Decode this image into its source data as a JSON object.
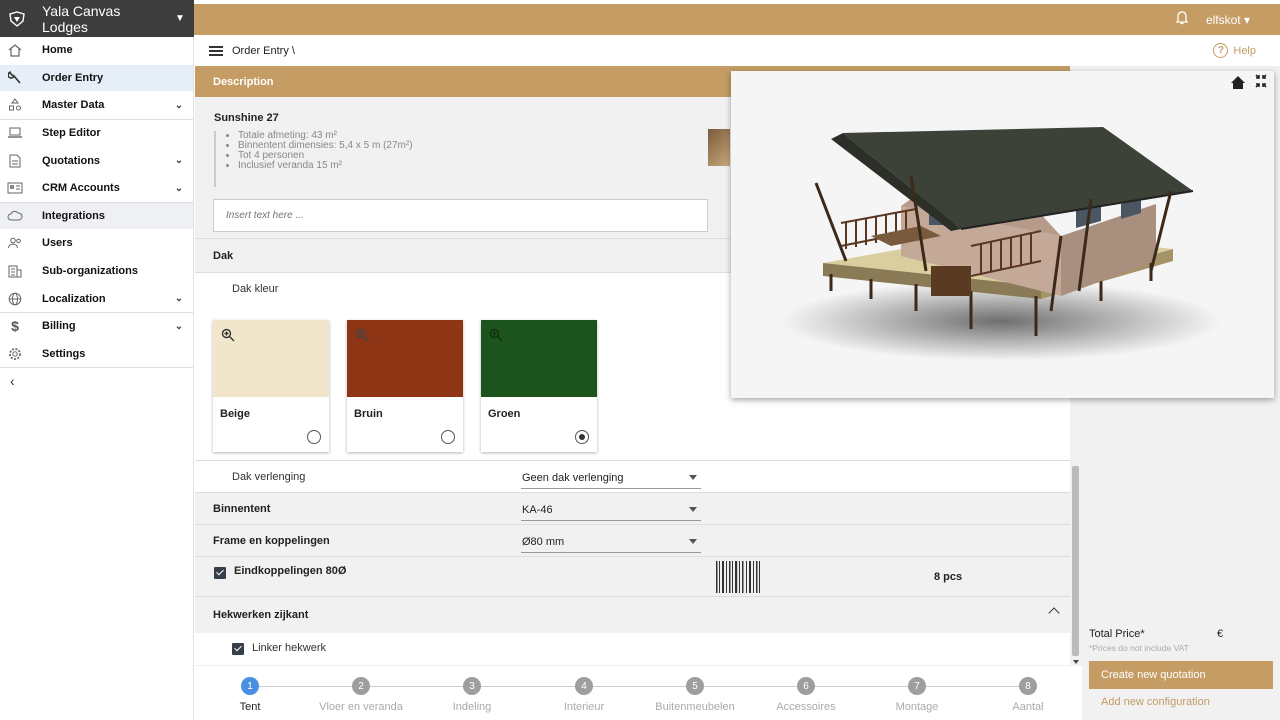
{
  "brand": {
    "name": "Yala Canvas Lodges"
  },
  "topbar": {
    "user": "elfskot"
  },
  "sidebar": {
    "items": [
      {
        "label": "Home",
        "icon": "home-icon"
      },
      {
        "label": "Order Entry",
        "icon": "wrench-icon"
      },
      {
        "label": "Master Data",
        "icon": "shapes-icon"
      },
      {
        "label": "Step Editor",
        "icon": "laptop-icon"
      },
      {
        "label": "Quotations",
        "icon": "document-icon"
      },
      {
        "label": "CRM Accounts",
        "icon": "id-card-icon"
      },
      {
        "label": "Integrations",
        "icon": "cloud-icon"
      },
      {
        "label": "Users",
        "icon": "users-icon"
      },
      {
        "label": "Sub-organizations",
        "icon": "building-icon"
      },
      {
        "label": "Localization",
        "icon": "globe-icon"
      },
      {
        "label": "Billing",
        "icon": "dollar-icon"
      },
      {
        "label": "Settings",
        "icon": "gear-icon"
      }
    ]
  },
  "breadcrumb": {
    "text": "Order Entry \\"
  },
  "help": {
    "label": "Help"
  },
  "description": {
    "header": "Description",
    "title": "Sunshine 27",
    "bullets": [
      "Totale afmeting: 43 m²",
      "Binnentent dimensies: 5,4 x 5 m (27m²)",
      "Tot 4 personen",
      "Inclusief veranda 15 m²"
    ],
    "input_placeholder": "Insert text here ..."
  },
  "dak": {
    "section_label": "Dak",
    "kleur_label": "Dak kleur",
    "swatches": [
      {
        "name": "Beige",
        "color": "#f1e6cc",
        "selected": false
      },
      {
        "name": "Bruin",
        "color": "#8e3516",
        "selected": false
      },
      {
        "name": "Groen",
        "color": "#1d531d",
        "selected": true
      }
    ]
  },
  "options": {
    "dak_verlenging": {
      "label": "Dak verlenging",
      "value": "Geen dak verlenging"
    },
    "binnentent": {
      "label": "Binnentent",
      "value": "KA-46"
    },
    "frame": {
      "label": "Frame en koppelingen",
      "value": "Ø80 mm"
    },
    "eindkoppelingen": {
      "label": "Eindkoppelingen 80Ø",
      "quantity": "8 pcs",
      "checked": true
    }
  },
  "hekwerken": {
    "label": "Hekwerken zijkant",
    "linker": {
      "label": "Linker hekwerk",
      "checked": true
    }
  },
  "stepper": {
    "steps": [
      {
        "num": "1",
        "label": "Tent",
        "active": true
      },
      {
        "num": "2",
        "label": "Vloer en veranda",
        "active": false
      },
      {
        "num": "3",
        "label": "Indeling",
        "active": false
      },
      {
        "num": "4",
        "label": "Interieur",
        "active": false
      },
      {
        "num": "5",
        "label": "Buitenmeubelen",
        "active": false
      },
      {
        "num": "6",
        "label": "Accessoires",
        "active": false
      },
      {
        "num": "7",
        "label": "Montage",
        "active": false
      },
      {
        "num": "8",
        "label": "Aantal",
        "active": false
      }
    ]
  },
  "pricing": {
    "total_label": "Total Price*",
    "currency": "€",
    "note": "*Prices do not include VAT",
    "create_button": "Create new quotation",
    "add_config": "Add new configuration"
  },
  "colors": {
    "accent": "#c49c64",
    "dark": "#3d3d3d",
    "active_step": "#4a90e2"
  }
}
